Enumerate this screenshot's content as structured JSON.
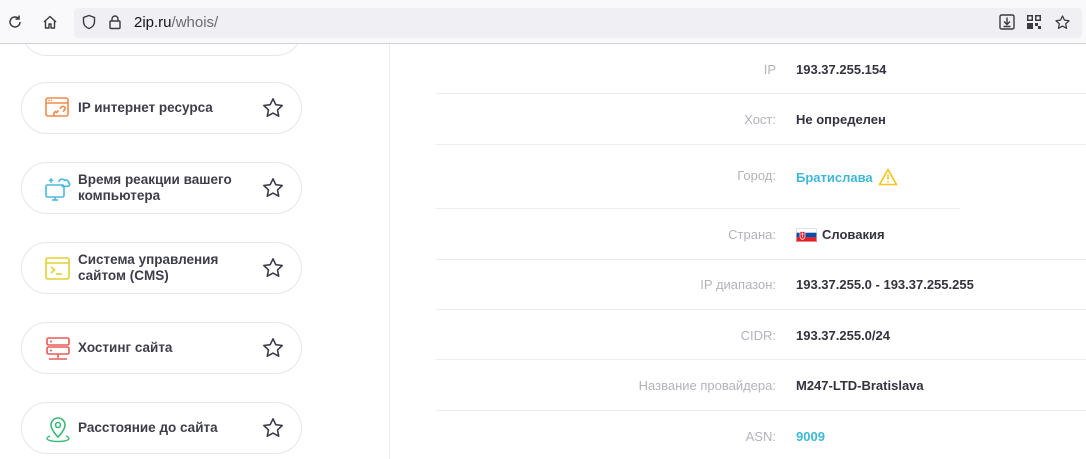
{
  "browser": {
    "url_domain": "2ip.ru",
    "url_path": "/whois/"
  },
  "sidebar": {
    "items": [
      {
        "label": "IP интернет ресурса"
      },
      {
        "label": "Время реакции вашего компьютера"
      },
      {
        "label": "Система управления сайтом (CMS)"
      },
      {
        "label": "Хостинг сайта"
      },
      {
        "label": "Расстояние до сайта"
      }
    ]
  },
  "whois": {
    "ip": {
      "key": "IP",
      "value": "193.37.255.154"
    },
    "host": {
      "key": "Хост:",
      "value": "Не определен"
    },
    "city": {
      "key": "Город:",
      "value": "Братислава"
    },
    "country": {
      "key": "Страна:",
      "value": "Словакия"
    },
    "range": {
      "key": "IP диапазон:",
      "value": "193.37.255.0 - 193.37.255.255"
    },
    "cidr": {
      "key": "CIDR:",
      "value": "193.37.255.0/24"
    },
    "provider": {
      "key": "Название провайдера:",
      "value": "M247-LTD-Bratislava"
    },
    "asn": {
      "key": "ASN:",
      "value": "9009"
    }
  },
  "colors": {
    "link": "#3fb8d6",
    "warning": "#f2c518"
  }
}
